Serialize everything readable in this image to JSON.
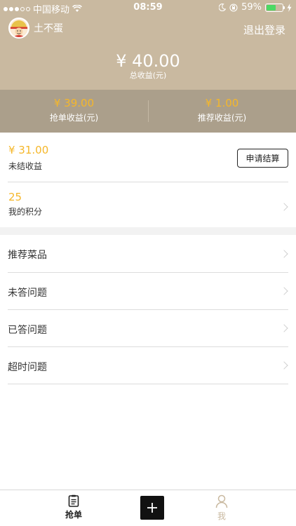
{
  "status_bar": {
    "carrier": "中国移动",
    "time": "08:59",
    "battery": "59%",
    "battery_level": 0.59,
    "icons": [
      "signal-dots",
      "wifi-icon",
      "moon-icon",
      "orientation-lock-icon",
      "battery-icon",
      "charging-icon"
    ]
  },
  "header": {
    "username": "土不蛋",
    "logout_label": "退出登录",
    "total_amount": "¥ 40.00",
    "total_label": "总收益(元)"
  },
  "earnings": {
    "grab": {
      "amount": "¥ 39.00",
      "label": "抢单收益(元)"
    },
    "recommend": {
      "amount": "¥ 1.00",
      "label": "推荐收益(元)"
    }
  },
  "unsettled": {
    "amount": "¥ 31.00",
    "label": "未结收益",
    "button_label": "申请结算"
  },
  "points": {
    "value": "25",
    "label": "我的积分"
  },
  "menu": [
    {
      "label": "推荐菜品"
    },
    {
      "label": "未答问题"
    },
    {
      "label": "已答问题"
    },
    {
      "label": "超时问题"
    }
  ],
  "tabbar": {
    "grab_label": "抢单",
    "me_label": "我",
    "accent_color": "#c9b9a0"
  },
  "colors": {
    "header_bg": "#c9b9a0",
    "split_bg": "#ab9f8b",
    "amount": "#f5b72a"
  }
}
